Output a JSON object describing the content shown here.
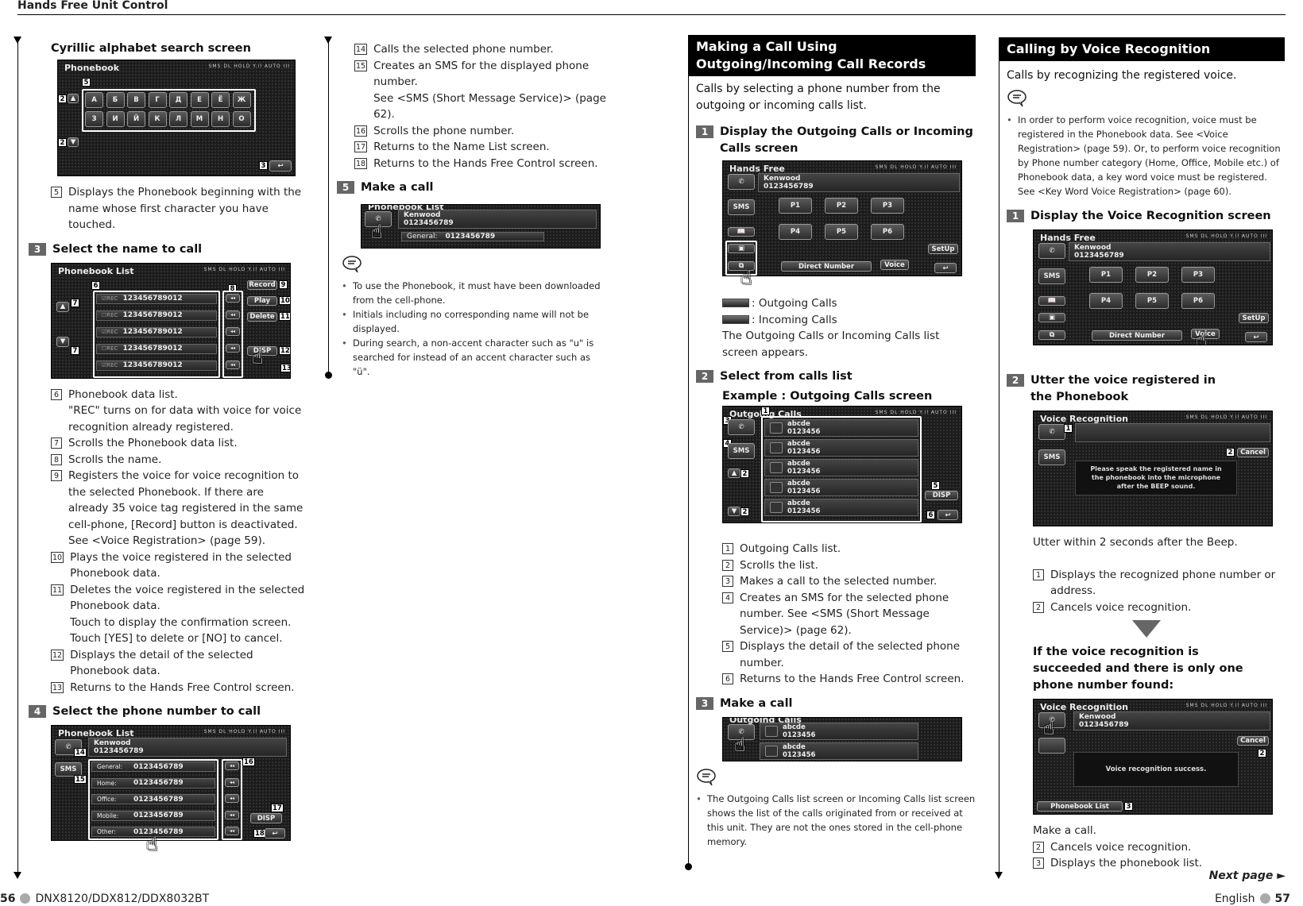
{
  "header": {
    "section_title": "Hands Free Unit Control"
  },
  "left": {
    "cyrillic": {
      "heading": "Cyrillic alphabet search screen",
      "screen_title": "Phonebook",
      "status_bar": "SMS  DL  HOLD  Y.il  AUTO  III",
      "letters_row1": [
        "А",
        "Б",
        "В",
        "Г",
        "Д",
        "Е",
        "Ё",
        "Ж"
      ],
      "letters_row2": [
        "З",
        "И",
        "Й",
        "К",
        "Л",
        "М",
        "Н",
        "О"
      ],
      "callouts": {
        "c5": "5",
        "c2a": "2",
        "c2b": "2",
        "c3": "3"
      }
    },
    "cyrillic_items": [
      {
        "n": "5",
        "text": "Displays the Phonebook beginning with the name whose first character you have touched."
      }
    ],
    "step3": {
      "num": "3",
      "title": "Select the name to call",
      "screen_title": "Phonebook List",
      "rows": [
        {
          "rec": "☑REC",
          "number": "123456789012"
        },
        {
          "rec": "☐REC",
          "number": "123456789012"
        },
        {
          "rec": "☑REC",
          "number": "123456789012"
        },
        {
          "rec": "☐REC",
          "number": "123456789012"
        },
        {
          "rec": "☑REC",
          "number": "123456789012"
        }
      ],
      "buttons": {
        "record": "Record",
        "play": "Play",
        "delete": "Delete",
        "disp": "DISP"
      },
      "callouts": {
        "c6": "6",
        "c7a": "7",
        "c7b": "7",
        "c8": "8",
        "c9": "9",
        "c10": "10",
        "c11": "11",
        "c12": "12",
        "c13": "13"
      }
    },
    "step3_items": [
      {
        "n": "6",
        "text": "Phonebook data list.\n\"REC\" turns on for data with voice for voice recognition already registered."
      },
      {
        "n": "7",
        "text": "Scrolls the Phonebook data list."
      },
      {
        "n": "8",
        "text": "Scrolls the name."
      },
      {
        "n": "9",
        "text": "Registers the voice for voice recognition to the selected Phonebook. If there are already 35 voice tag registered in the same cell-phone, [Record] button is deactivated.\nSee <Voice Registration> (page 59)."
      },
      {
        "n": "10",
        "text": "Plays the voice registered in the selected Phonebook data."
      },
      {
        "n": "11",
        "text": "Deletes the voice registered in the selected Phonebook data.\nTouch to display the confirmation screen.\nTouch [YES] to delete or [NO] to cancel."
      },
      {
        "n": "12",
        "text": "Displays the detail of the selected Phonebook data."
      },
      {
        "n": "13",
        "text": "Returns to the Hands Free Control screen."
      }
    ],
    "step4": {
      "num": "4",
      "title": "Select the phone number to call",
      "screen_title": "Phonebook List",
      "name": "Kenwood",
      "number": "0123456789",
      "sms": "SMS",
      "rows": [
        {
          "label": "General:",
          "number": "0123456789"
        },
        {
          "label": "Home:",
          "number": "0123456789"
        },
        {
          "label": "Office:",
          "number": "0123456789"
        },
        {
          "label": "Mobile:",
          "number": "0123456789"
        },
        {
          "label": "Other:",
          "number": "0123456789"
        }
      ],
      "disp": "DISP",
      "callouts": {
        "c14": "14",
        "c15": "15",
        "c16": "16",
        "c17": "17",
        "c18": "18"
      }
    }
  },
  "middle": {
    "step4_items": [
      {
        "n": "14",
        "text": "Calls the selected phone number."
      },
      {
        "n": "15",
        "text": "Creates an SMS for the displayed phone number.\nSee <SMS (Short Message Service)> (page 62)."
      },
      {
        "n": "16",
        "text": "Scrolls the phone number."
      },
      {
        "n": "17",
        "text": "Returns to the Name List screen."
      },
      {
        "n": "18",
        "text": "Returns to the Hands Free Control screen."
      }
    ],
    "step5": {
      "num": "5",
      "title": "Make a call",
      "screen_title": "Phonebook List",
      "name": "Kenwood",
      "number": "0123456789",
      "row_label": "General:",
      "row_number": "0123456789"
    },
    "notes": [
      "To use the Phonebook, it must have been downloaded from the cell-phone.",
      "Initials including no corresponding name will not be displayed.",
      "During search, a non-accent character such as \"u\" is searched for instead of an accent character such as \"ü\"."
    ]
  },
  "outgoing": {
    "banner": "Making a Call Using Outgoing/Incoming Call Records",
    "lead": "Calls by selecting a phone number from the outgoing or incoming calls list.",
    "step1": {
      "num": "1",
      "title": "Display the Outgoing Calls or Incoming Calls screen",
      "screen_title": "Hands Free",
      "name": "Kenwood",
      "number": "0123456789",
      "presets": [
        "P1",
        "P2",
        "P3",
        "P4",
        "P5",
        "P6"
      ],
      "sms": "SMS",
      "direct": "Direct Number",
      "voice": "Voice",
      "setup": "SetUp"
    },
    "legend": [
      {
        "label": ": Outgoing Calls"
      },
      {
        "label": ": Incoming Calls"
      }
    ],
    "step1_text": "The Outgoing Calls or Incoming Calls list screen appears.",
    "step2": {
      "num": "2",
      "title": "Select from calls list",
      "example": "Example : Outgoing Calls screen",
      "screen_title": "Outgoing Calls",
      "rows": [
        {
          "name": "abcde",
          "number": "0123456"
        },
        {
          "name": "abcde",
          "number": "0123456"
        },
        {
          "name": "abcde",
          "number": "0123456"
        },
        {
          "name": "abcde",
          "number": "0123456"
        },
        {
          "name": "abcde",
          "number": "0123456"
        }
      ],
      "sms": "SMS",
      "disp": "DISP",
      "callouts": {
        "c1": "1",
        "c2a": "2",
        "c2b": "2",
        "c3": "3",
        "c4": "4",
        "c5": "5",
        "c6": "6"
      }
    },
    "step2_items": [
      {
        "n": "1",
        "text": "Outgoing Calls list."
      },
      {
        "n": "2",
        "text": "Scrolls the list."
      },
      {
        "n": "3",
        "text": "Makes a call to the selected number."
      },
      {
        "n": "4",
        "text": "Creates an SMS for the selected phone number. See <SMS (Short Message Service)> (page 62)."
      },
      {
        "n": "5",
        "text": "Displays the detail of the selected phone number."
      },
      {
        "n": "6",
        "text": "Returns to the Hands Free Control screen."
      }
    ],
    "step3": {
      "num": "3",
      "title": "Make a call",
      "screen_title": "Outgoing Calls",
      "rows": [
        {
          "name": "abcde",
          "number": "0123456"
        },
        {
          "name": "abcde",
          "number": "0123456"
        }
      ]
    },
    "notes": [
      "The Outgoing Calls list screen or Incoming Calls list screen shows the list of the calls originated from or received at this unit. They are not the ones stored in the cell-phone memory."
    ]
  },
  "voice": {
    "banner": "Calling by Voice Recognition",
    "lead": "Calls by recognizing the registered voice.",
    "notes": [
      "In order to perform voice recognition, voice must be registered in the Phonebook  data. See <Voice Registration> (page 59). Or, to perform voice recognition by Phone number category (Home, Office, Mobile etc.) of Phonebook data, a key word voice must be registered. See <Key Word Voice Registration> (page 60)."
    ],
    "step1": {
      "num": "1",
      "title": "Display the Voice Recognition screen",
      "screen_title": "Hands Free",
      "name": "Kenwood",
      "number": "0123456789",
      "presets": [
        "P1",
        "P2",
        "P3",
        "P4",
        "P5",
        "P6"
      ],
      "sms": "SMS",
      "direct": "Direct Number",
      "voice": "Voice",
      "setup": "SetUp"
    },
    "step2": {
      "num": "2",
      "title": "Utter the voice registered in the Phonebook",
      "screen_title": "Voice Recognition",
      "cancel": "Cancel",
      "sms": "SMS",
      "message": "Please speak the registered name in the phonebook into the microphone after the BEEP sound.",
      "callouts": {
        "c1": "1",
        "c2": "2"
      }
    },
    "step2_text": "Utter within 2 seconds after the Beep.",
    "step2_items": [
      {
        "n": "1",
        "text": "Displays the recognized phone number or address."
      },
      {
        "n": "2",
        "text": "Cancels voice recognition."
      }
    ],
    "success": {
      "heading": "If the voice recognition is succeeded and there is only one phone number found:",
      "screen_title": "Voice Recognition",
      "name": "Kenwood",
      "number": "0123456789",
      "cancel": "Cancel",
      "message": "Voice recognition success.",
      "phonebook_list": "Phonebook List",
      "callouts": {
        "c2": "2",
        "c3": "3"
      }
    },
    "success_text": "Make a call.",
    "success_items": [
      {
        "n": "2",
        "text": "Cancels voice recognition."
      },
      {
        "n": "3",
        "text": "Displays the phonebook list."
      }
    ],
    "next_page": "Next page ►"
  },
  "footer": {
    "left_page": "56",
    "left_model": "DNX8120/DDX812/DDX8032BT",
    "right_lang": "English",
    "right_page": "57"
  }
}
